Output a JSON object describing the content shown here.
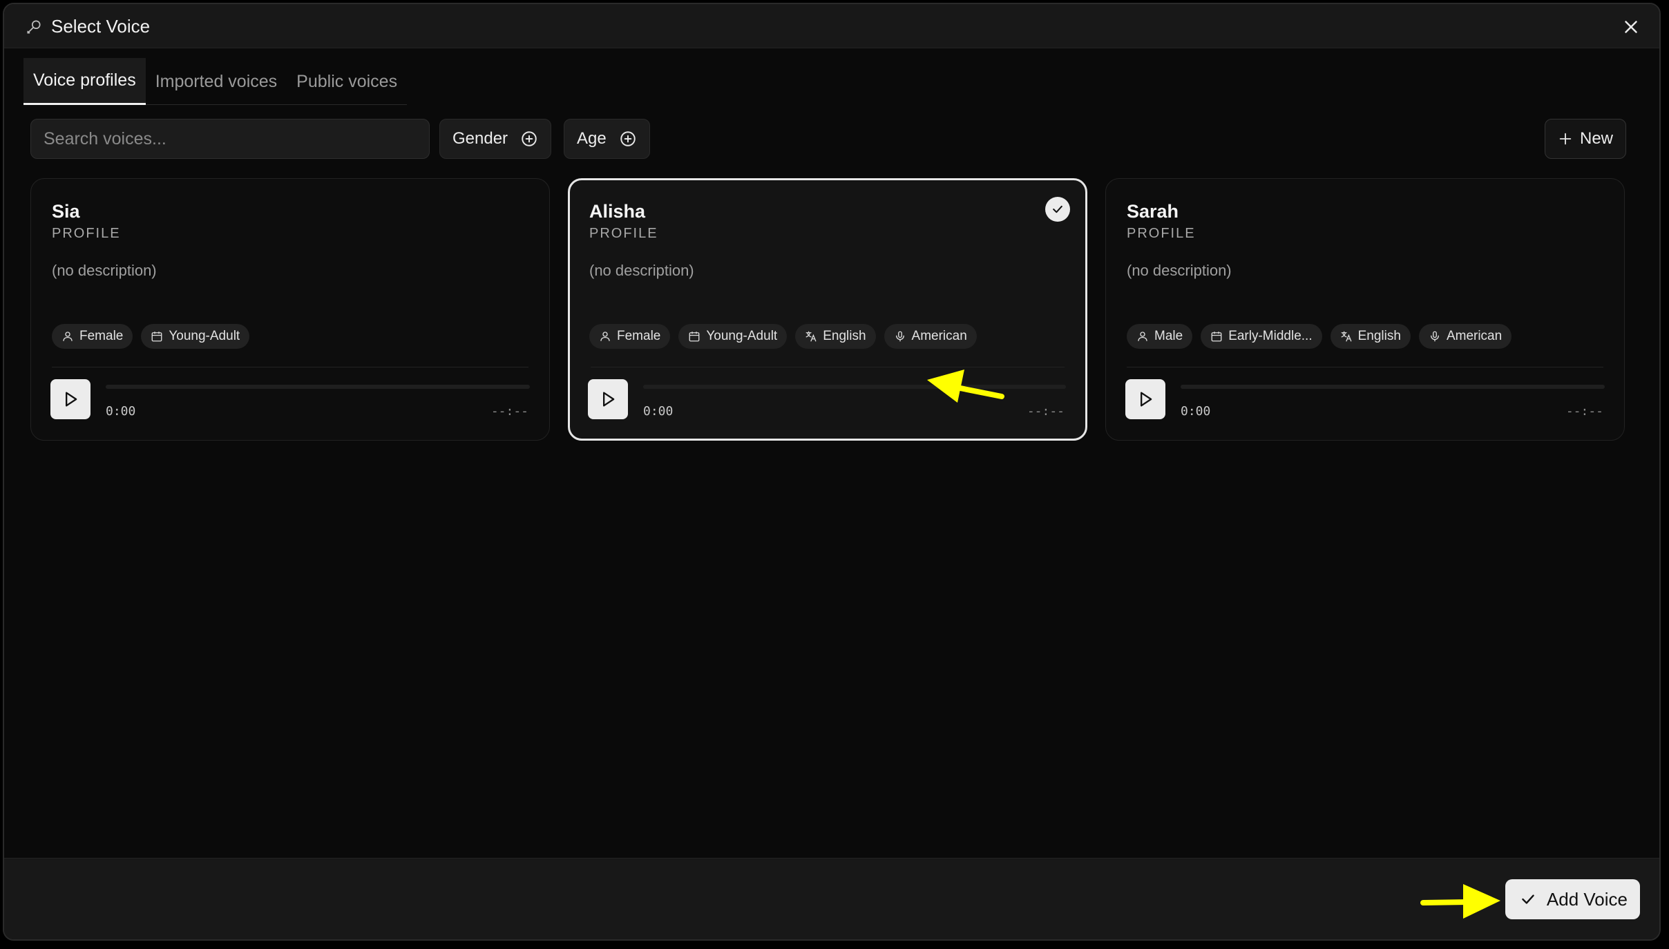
{
  "dialog": {
    "title": "Select Voice",
    "title_icon": "microphone-icon",
    "close_icon": "close-icon"
  },
  "tabs": [
    {
      "label": "Voice profiles",
      "active": true
    },
    {
      "label": "Imported voices",
      "active": false
    },
    {
      "label": "Public voices",
      "active": false
    }
  ],
  "toolbar": {
    "search_placeholder": "Search voices...",
    "gender_label": "Gender",
    "age_label": "Age",
    "new_label": "New"
  },
  "cards": [
    {
      "name": "Sia",
      "type": "PROFILE",
      "description": "(no description)",
      "selected": false,
      "tags": [
        {
          "icon": "person-icon",
          "label": "Female"
        },
        {
          "icon": "calendar-icon",
          "label": "Young-Adult"
        }
      ],
      "time_current": "0:00",
      "time_total": "--:--"
    },
    {
      "name": "Alisha",
      "type": "PROFILE",
      "description": "(no description)",
      "selected": true,
      "tags": [
        {
          "icon": "person-icon",
          "label": "Female"
        },
        {
          "icon": "calendar-icon",
          "label": "Young-Adult"
        },
        {
          "icon": "language-icon",
          "label": "English"
        },
        {
          "icon": "microphone-icon",
          "label": "American"
        }
      ],
      "time_current": "0:00",
      "time_total": "--:--"
    },
    {
      "name": "Sarah",
      "type": "PROFILE",
      "description": "(no description)",
      "selected": false,
      "tags": [
        {
          "icon": "person-icon",
          "label": "Male"
        },
        {
          "icon": "calendar-icon",
          "label": "Early-Middle..."
        },
        {
          "icon": "language-icon",
          "label": "English"
        },
        {
          "icon": "microphone-icon",
          "label": "American"
        }
      ],
      "time_current": "0:00",
      "time_total": "--:--"
    }
  ],
  "footer": {
    "add_label": "Add Voice"
  },
  "colors": {
    "background": "#0a0a0a",
    "surface": "#181818",
    "accent": "#ececec",
    "annotation": "#ffff00"
  }
}
